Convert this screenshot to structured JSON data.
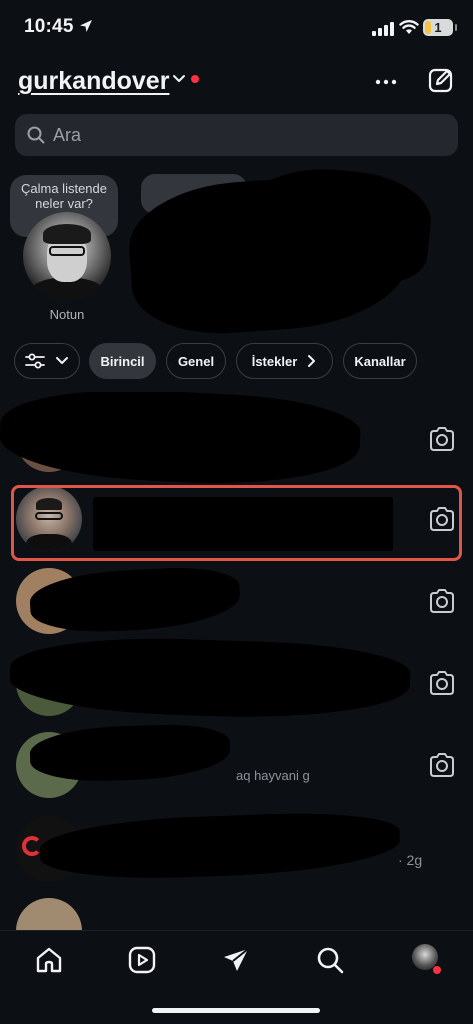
{
  "status_bar": {
    "time": "10:45",
    "battery_level": "1"
  },
  "header": {
    "username": "gurkandover"
  },
  "search": {
    "placeholder": "Ara"
  },
  "notes": {
    "own_note_text": "Çalma listende neler var?",
    "own_note_label": "Notun"
  },
  "filters": {
    "chips": [
      {
        "label": "Birincil",
        "active": true
      },
      {
        "label": "Genel",
        "active": false
      },
      {
        "label": "İstekler",
        "active": false
      },
      {
        "label": "Kanallar",
        "active": false
      }
    ]
  },
  "messages": [
    {
      "preview": ""
    },
    {
      "preview": ""
    },
    {
      "preview": ""
    },
    {
      "preview": ""
    },
    {
      "preview": "aq hayvani g"
    },
    {
      "preview": "· 2g"
    },
    {
      "preview": ""
    }
  ],
  "colors": {
    "background": "#0c0f14",
    "accent_red": "#ff3040",
    "highlight_border": "#e0574a",
    "chip_active": "#33363c"
  }
}
